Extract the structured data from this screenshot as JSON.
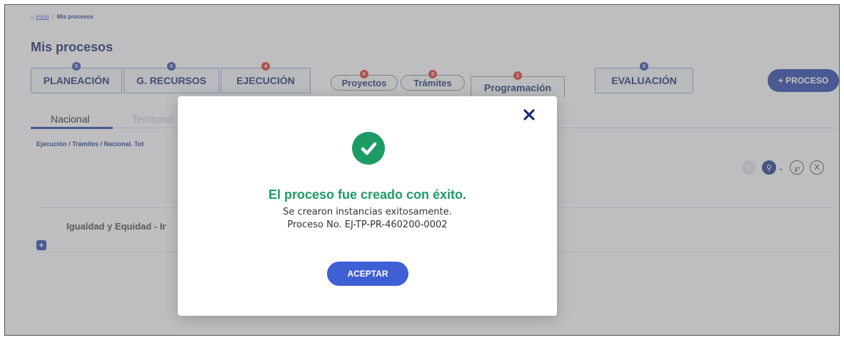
{
  "breadcrumb": {
    "home": "Inicio",
    "separator": "/",
    "current": "Mis procesos"
  },
  "page_title": "Mis procesos",
  "steps": {
    "planeacion": {
      "label": "PLANEACIÓN",
      "badge": "0"
    },
    "recursos": {
      "label": "G. RECURSOS",
      "badge": "0"
    },
    "ejecucion": {
      "label": "EJECUCIÓN",
      "badge": "4"
    },
    "evaluacion": {
      "label": "EVALUACIÓN",
      "badge": "0"
    }
  },
  "subprocesses": {
    "proyectos": {
      "label": "Proyectos",
      "badge": "0"
    },
    "tramites": {
      "label": "Trámites",
      "badge": "3"
    },
    "programacion": {
      "label": "Programación",
      "badge": "1"
    }
  },
  "add_process_label": "+ PROCESO",
  "tabs": {
    "nacional": "Nacional",
    "territorial": "Territorial"
  },
  "path_text": "Ejecución / Trámites / Nacional. Tot",
  "row_title": "Igualdad y Equidad - Ir",
  "colors": {
    "primary": "#2541a8",
    "success": "#1d9b64",
    "danger": "#d9382e",
    "button": "#3f5fd4"
  },
  "modal": {
    "title": "El proceso fue creado con éxito.",
    "line1": "Se crearon instancias exitosamente.",
    "line2": "Proceso No. EJ-TP-PR-460200-0002",
    "accept_label": "ACEPTAR",
    "close_icon": "close-icon",
    "status_icon": "check-circle-icon"
  }
}
